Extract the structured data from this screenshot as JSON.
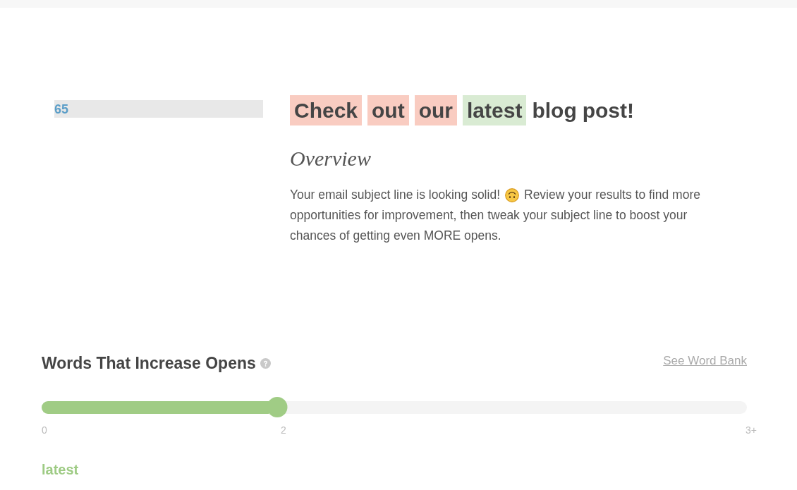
{
  "score": {
    "value": "65"
  },
  "headline": {
    "words": [
      {
        "text": "Check",
        "color": "#f9ccc1"
      },
      {
        "text": "out",
        "color": "#f9ccc1"
      },
      {
        "text": "our",
        "color": "#f9ccc1"
      },
      {
        "text": "latest",
        "color": "#d9ebd3"
      },
      {
        "text": "blog"
      },
      {
        "text": "post!"
      }
    ]
  },
  "overview": {
    "title": "Overview",
    "lines": [
      "Your email subject line is looking solid!",
      "Review your results to find more",
      "opportunities for improvement, then tweak your subject line to boost your",
      "chances of getting even MORE opens."
    ]
  },
  "words_section": {
    "title": "Words That Increase Opens",
    "link": "See Word Bank",
    "slider": {
      "level": 0.334,
      "min_label": "0",
      "value_label": "2",
      "max_label": "3+"
    },
    "words": [
      "latest"
    ]
  }
}
